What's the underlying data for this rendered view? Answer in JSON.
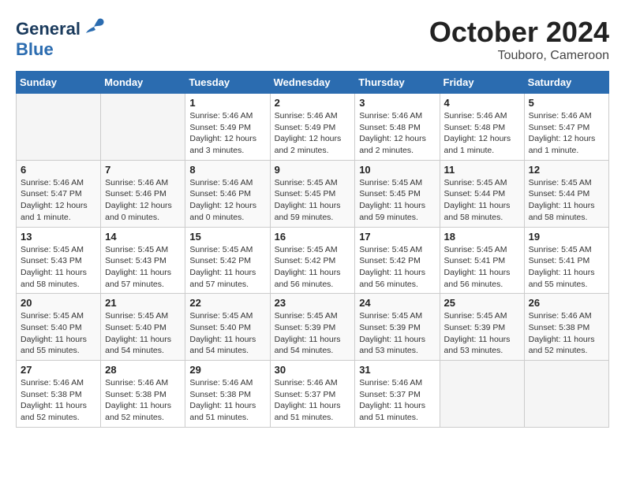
{
  "header": {
    "logo_line1": "General",
    "logo_line2": "Blue",
    "month": "October 2024",
    "location": "Touboro, Cameroon"
  },
  "weekdays": [
    "Sunday",
    "Monday",
    "Tuesday",
    "Wednesday",
    "Thursday",
    "Friday",
    "Saturday"
  ],
  "weeks": [
    [
      {
        "day": "",
        "info": ""
      },
      {
        "day": "",
        "info": ""
      },
      {
        "day": "1",
        "info": "Sunrise: 5:46 AM\nSunset: 5:49 PM\nDaylight: 12 hours\nand 3 minutes."
      },
      {
        "day": "2",
        "info": "Sunrise: 5:46 AM\nSunset: 5:49 PM\nDaylight: 12 hours\nand 2 minutes."
      },
      {
        "day": "3",
        "info": "Sunrise: 5:46 AM\nSunset: 5:48 PM\nDaylight: 12 hours\nand 2 minutes."
      },
      {
        "day": "4",
        "info": "Sunrise: 5:46 AM\nSunset: 5:48 PM\nDaylight: 12 hours\nand 1 minute."
      },
      {
        "day": "5",
        "info": "Sunrise: 5:46 AM\nSunset: 5:47 PM\nDaylight: 12 hours\nand 1 minute."
      }
    ],
    [
      {
        "day": "6",
        "info": "Sunrise: 5:46 AM\nSunset: 5:47 PM\nDaylight: 12 hours\nand 1 minute."
      },
      {
        "day": "7",
        "info": "Sunrise: 5:46 AM\nSunset: 5:46 PM\nDaylight: 12 hours\nand 0 minutes."
      },
      {
        "day": "8",
        "info": "Sunrise: 5:46 AM\nSunset: 5:46 PM\nDaylight: 12 hours\nand 0 minutes."
      },
      {
        "day": "9",
        "info": "Sunrise: 5:45 AM\nSunset: 5:45 PM\nDaylight: 11 hours\nand 59 minutes."
      },
      {
        "day": "10",
        "info": "Sunrise: 5:45 AM\nSunset: 5:45 PM\nDaylight: 11 hours\nand 59 minutes."
      },
      {
        "day": "11",
        "info": "Sunrise: 5:45 AM\nSunset: 5:44 PM\nDaylight: 11 hours\nand 58 minutes."
      },
      {
        "day": "12",
        "info": "Sunrise: 5:45 AM\nSunset: 5:44 PM\nDaylight: 11 hours\nand 58 minutes."
      }
    ],
    [
      {
        "day": "13",
        "info": "Sunrise: 5:45 AM\nSunset: 5:43 PM\nDaylight: 11 hours\nand 58 minutes."
      },
      {
        "day": "14",
        "info": "Sunrise: 5:45 AM\nSunset: 5:43 PM\nDaylight: 11 hours\nand 57 minutes."
      },
      {
        "day": "15",
        "info": "Sunrise: 5:45 AM\nSunset: 5:42 PM\nDaylight: 11 hours\nand 57 minutes."
      },
      {
        "day": "16",
        "info": "Sunrise: 5:45 AM\nSunset: 5:42 PM\nDaylight: 11 hours\nand 56 minutes."
      },
      {
        "day": "17",
        "info": "Sunrise: 5:45 AM\nSunset: 5:42 PM\nDaylight: 11 hours\nand 56 minutes."
      },
      {
        "day": "18",
        "info": "Sunrise: 5:45 AM\nSunset: 5:41 PM\nDaylight: 11 hours\nand 56 minutes."
      },
      {
        "day": "19",
        "info": "Sunrise: 5:45 AM\nSunset: 5:41 PM\nDaylight: 11 hours\nand 55 minutes."
      }
    ],
    [
      {
        "day": "20",
        "info": "Sunrise: 5:45 AM\nSunset: 5:40 PM\nDaylight: 11 hours\nand 55 minutes."
      },
      {
        "day": "21",
        "info": "Sunrise: 5:45 AM\nSunset: 5:40 PM\nDaylight: 11 hours\nand 54 minutes."
      },
      {
        "day": "22",
        "info": "Sunrise: 5:45 AM\nSunset: 5:40 PM\nDaylight: 11 hours\nand 54 minutes."
      },
      {
        "day": "23",
        "info": "Sunrise: 5:45 AM\nSunset: 5:39 PM\nDaylight: 11 hours\nand 54 minutes."
      },
      {
        "day": "24",
        "info": "Sunrise: 5:45 AM\nSunset: 5:39 PM\nDaylight: 11 hours\nand 53 minutes."
      },
      {
        "day": "25",
        "info": "Sunrise: 5:45 AM\nSunset: 5:39 PM\nDaylight: 11 hours\nand 53 minutes."
      },
      {
        "day": "26",
        "info": "Sunrise: 5:46 AM\nSunset: 5:38 PM\nDaylight: 11 hours\nand 52 minutes."
      }
    ],
    [
      {
        "day": "27",
        "info": "Sunrise: 5:46 AM\nSunset: 5:38 PM\nDaylight: 11 hours\nand 52 minutes."
      },
      {
        "day": "28",
        "info": "Sunrise: 5:46 AM\nSunset: 5:38 PM\nDaylight: 11 hours\nand 52 minutes."
      },
      {
        "day": "29",
        "info": "Sunrise: 5:46 AM\nSunset: 5:38 PM\nDaylight: 11 hours\nand 51 minutes."
      },
      {
        "day": "30",
        "info": "Sunrise: 5:46 AM\nSunset: 5:37 PM\nDaylight: 11 hours\nand 51 minutes."
      },
      {
        "day": "31",
        "info": "Sunrise: 5:46 AM\nSunset: 5:37 PM\nDaylight: 11 hours\nand 51 minutes."
      },
      {
        "day": "",
        "info": ""
      },
      {
        "day": "",
        "info": ""
      }
    ]
  ]
}
